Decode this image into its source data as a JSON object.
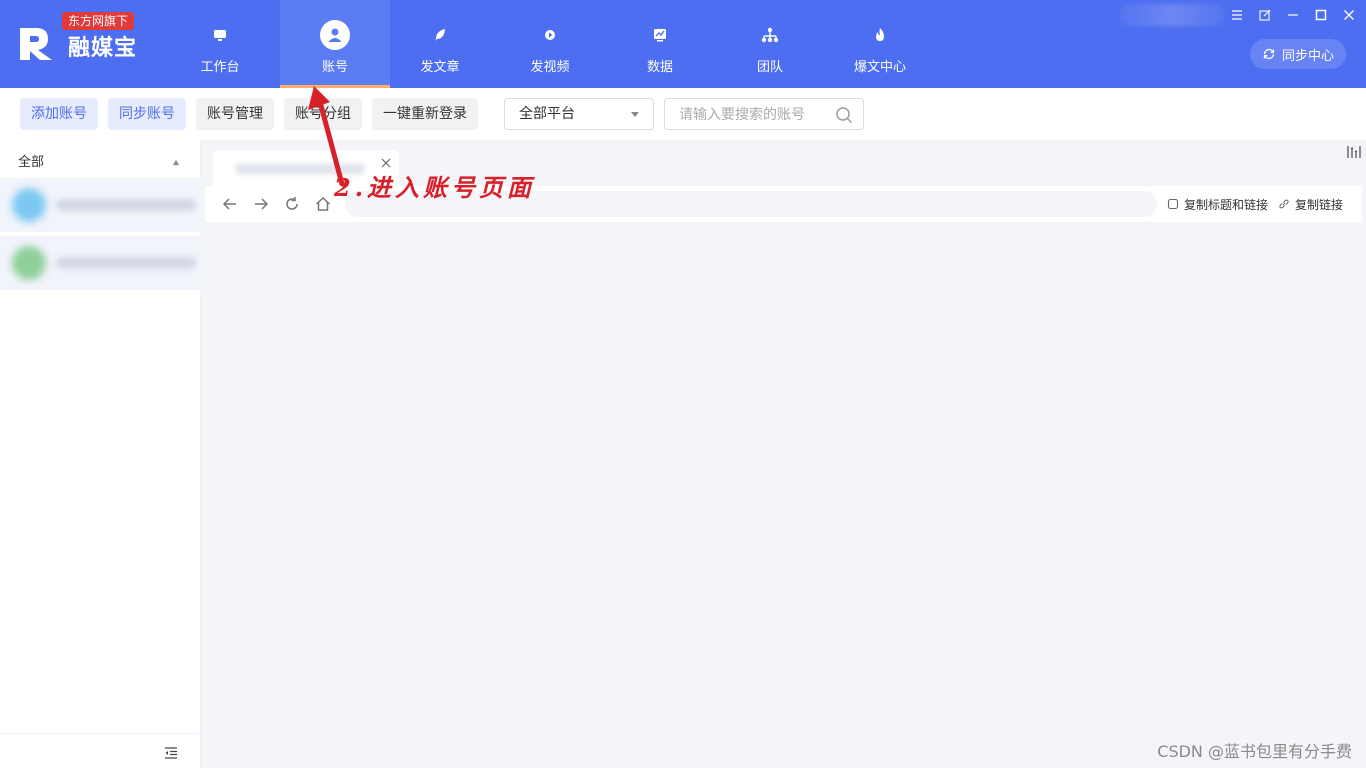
{
  "brand": {
    "name": "融媒宝",
    "badge": "东方网旗下"
  },
  "nav": [
    {
      "label": "工作台",
      "icon": "monitor-icon"
    },
    {
      "label": "账号",
      "icon": "user-icon",
      "active": true
    },
    {
      "label": "发文章",
      "icon": "feather-icon"
    },
    {
      "label": "发视频",
      "icon": "play-icon"
    },
    {
      "label": "数据",
      "icon": "chart-icon"
    },
    {
      "label": "团队",
      "icon": "org-chart-icon"
    },
    {
      "label": "爆文中心",
      "icon": "flame-icon"
    }
  ],
  "header": {
    "sync_center": "同步中心"
  },
  "toolbar": {
    "add_account": "添加账号",
    "sync_account": "同步账号",
    "manage_account": "账号管理",
    "group_account": "账号分组",
    "relogin_all": "一键重新登录",
    "platform_selected": "全部平台",
    "search_placeholder": "请输入要搜索的账号"
  },
  "sidebar": {
    "group_label": "全部"
  },
  "browser": {
    "copy_title_link": "复制标题和链接",
    "copy_link": "复制链接"
  },
  "annotation": {
    "text": "2.进入账号页面"
  },
  "watermark": "CSDN @蓝书包里有分手费",
  "colors": {
    "brand_blue": "#4d6ef0",
    "active_underline": "#ffb066",
    "annotation_red": "#d8202a"
  }
}
